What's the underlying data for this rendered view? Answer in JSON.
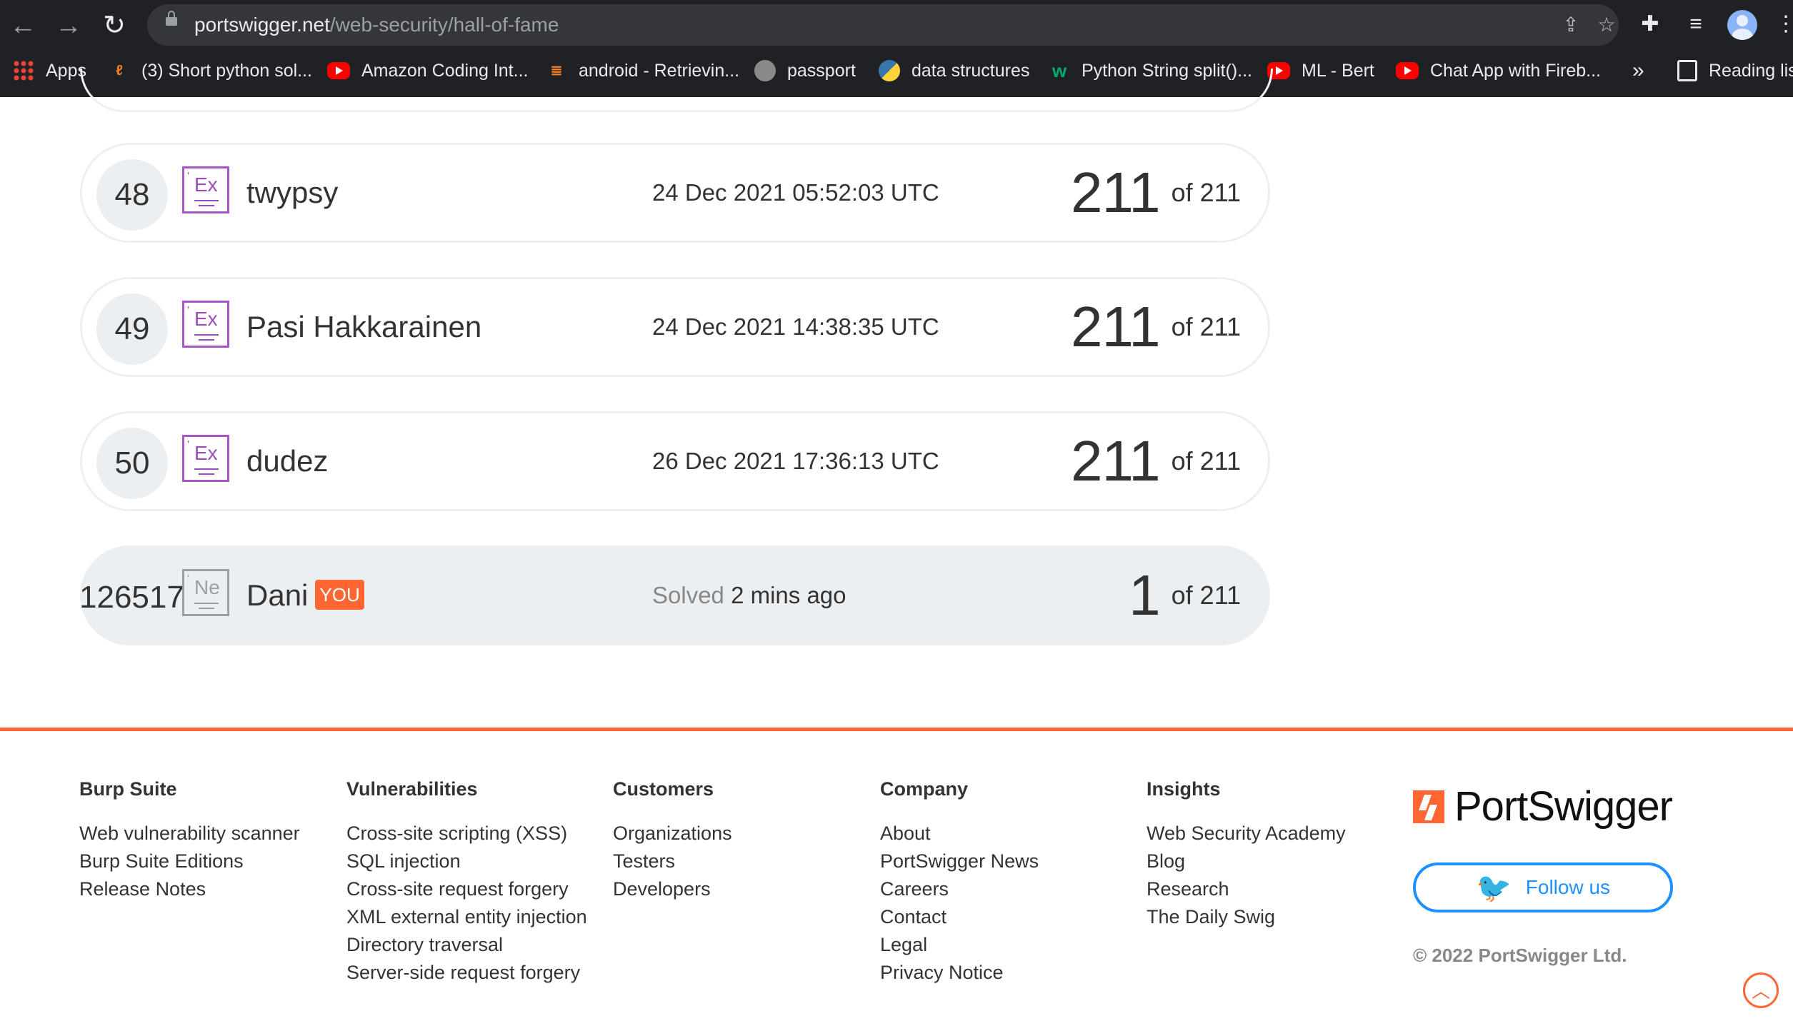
{
  "browser": {
    "url_domain": "portswigger.net",
    "url_path": "/web-security/hall-of-fame",
    "bookmarks": [
      {
        "label": "Apps",
        "icon": "apps-grid-icon"
      },
      {
        "label": "(3) Short python sol...",
        "icon": "leetcode-icon"
      },
      {
        "label": "Amazon Coding Int...",
        "icon": "youtube-icon"
      },
      {
        "label": "android - Retrievin...",
        "icon": "stackoverflow-icon"
      },
      {
        "label": "passport",
        "icon": "globe-icon"
      },
      {
        "label": "data structures",
        "icon": "python-icon"
      },
      {
        "label": "Python String split()...",
        "icon": "w3schools-icon"
      },
      {
        "label": "ML - Bert",
        "icon": "youtube-icon"
      },
      {
        "label": "Chat App with Fireb...",
        "icon": "youtube-icon"
      }
    ],
    "more_bookmarks": "»",
    "reading_list": "Reading list"
  },
  "leaderboard": {
    "rows": [
      {
        "rank": "48",
        "badge": "Ex",
        "name": "twypsy",
        "date": "24 Dec 2021 05:52:03 UTC",
        "score": "211",
        "of": "of 211"
      },
      {
        "rank": "49",
        "badge": "Ex",
        "name": "Pasi Hakkarainen",
        "date": "24 Dec 2021 14:38:35 UTC",
        "score": "211",
        "of": "of 211"
      },
      {
        "rank": "50",
        "badge": "Ex",
        "name": "dudez",
        "date": "26 Dec 2021 17:36:13 UTC",
        "score": "211",
        "of": "of 211"
      }
    ],
    "me": {
      "rank": "126517",
      "badge": "Ne",
      "name": "Dani",
      "you_tag": "YOU",
      "solved_prefix": "Solved",
      "solved_time": "2 mins ago",
      "score": "1",
      "of": "of 211"
    }
  },
  "footer": {
    "columns": [
      {
        "heading": "Burp Suite",
        "links": [
          "Web vulnerability scanner",
          "Burp Suite Editions",
          "Release Notes"
        ]
      },
      {
        "heading": "Vulnerabilities",
        "links": [
          "Cross-site scripting (XSS)",
          "SQL injection",
          "Cross-site request forgery",
          "XML external entity injection",
          "Directory traversal",
          "Server-side request forgery"
        ]
      },
      {
        "heading": "Customers",
        "links": [
          "Organizations",
          "Testers",
          "Developers"
        ]
      },
      {
        "heading": "Company",
        "links": [
          "About",
          "PortSwigger News",
          "Careers",
          "Contact",
          "Legal",
          "Privacy Notice"
        ]
      },
      {
        "heading": "Insights",
        "links": [
          "Web Security Academy",
          "Blog",
          "Research",
          "The Daily Swig"
        ]
      }
    ],
    "brand": "PortSwigger",
    "follow_label": "Follow us",
    "copyright": "© 2022 PortSwigger Ltd."
  },
  "colors": {
    "accent": "#ff6633",
    "twitter": "#1e90ff",
    "expert_badge": "#a855c7"
  }
}
